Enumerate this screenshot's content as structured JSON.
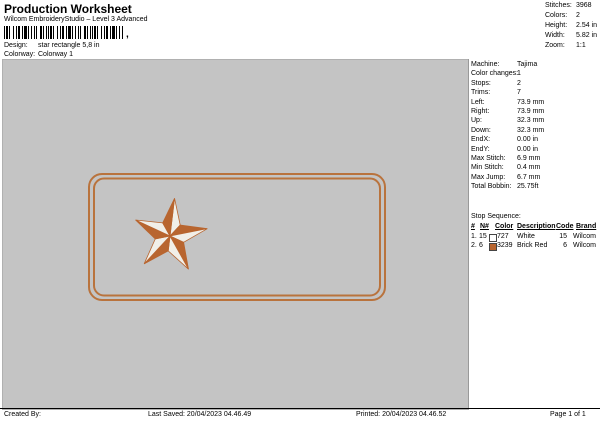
{
  "header": {
    "title": "Production Worksheet",
    "subtitle": "Wilcom EmbroideryStudio – Level 3 Advanced",
    "barcode_suffix": ","
  },
  "meta": {
    "design_label": "Design:",
    "design_value": "star rectangle 5,8 in",
    "colorway_label": "Colorway:",
    "colorway_value": "Colorway 1"
  },
  "top_stats": [
    {
      "label": "Stitches:",
      "value": "3968"
    },
    {
      "label": "Colors:",
      "value": "2"
    },
    {
      "label": "Height:",
      "value": "2.54 in"
    },
    {
      "label": "Width:",
      "value": "5.82 in"
    },
    {
      "label": "Zoom:",
      "value": "1:1"
    }
  ],
  "machine_info": [
    {
      "label": "Machine:",
      "value": "Tajima"
    },
    {
      "label": "Color changes:",
      "value": "1"
    },
    {
      "label": "Stops:",
      "value": "2"
    },
    {
      "label": "Trims:",
      "value": "7"
    },
    {
      "label": "Left:",
      "value": "73.9 mm"
    },
    {
      "label": "Right:",
      "value": "73.9 mm"
    },
    {
      "label": "Up:",
      "value": "32.3 mm"
    },
    {
      "label": "Down:",
      "value": "32.3 mm"
    },
    {
      "label": "EndX:",
      "value": "0.00 in"
    },
    {
      "label": "EndY:",
      "value": "0.00 in"
    },
    {
      "label": "Max Stitch:",
      "value": "6.9 mm"
    },
    {
      "label": "Min Stitch:",
      "value": "0.4 mm"
    },
    {
      "label": "Max Jump:",
      "value": "6.7 mm"
    },
    {
      "label": "Total Bobbin:",
      "value": "25.75ft"
    }
  ],
  "stop_sequence": {
    "title": "Stop Sequence:",
    "headers": [
      "#",
      "N#",
      "Color",
      "Description",
      "Code",
      "Brand"
    ],
    "header_brand_visible": "Brand",
    "rows": [
      {
        "num": "1.",
        "needle": "15",
        "swatch": "#ffffff",
        "color": "727",
        "description": "White",
        "code": "15",
        "brand": "Wilcom"
      },
      {
        "num": "2.",
        "needle": "6",
        "swatch": "#b8652f",
        "color": "3239",
        "description": "Brick Red",
        "code": "6",
        "brand": "Wilcom"
      }
    ]
  },
  "colors": {
    "outline": "#b9733d",
    "star_dark": "#b8652f",
    "star_light": "#f1efe8",
    "canvas_bg": "#c4c4c4"
  },
  "footer": {
    "created_by": "Created By:",
    "last_saved": "Last Saved: 20/04/2023 04.46.49",
    "printed": "Printed: 20/04/2023 04.46.52",
    "page": "Page 1 of 1"
  }
}
